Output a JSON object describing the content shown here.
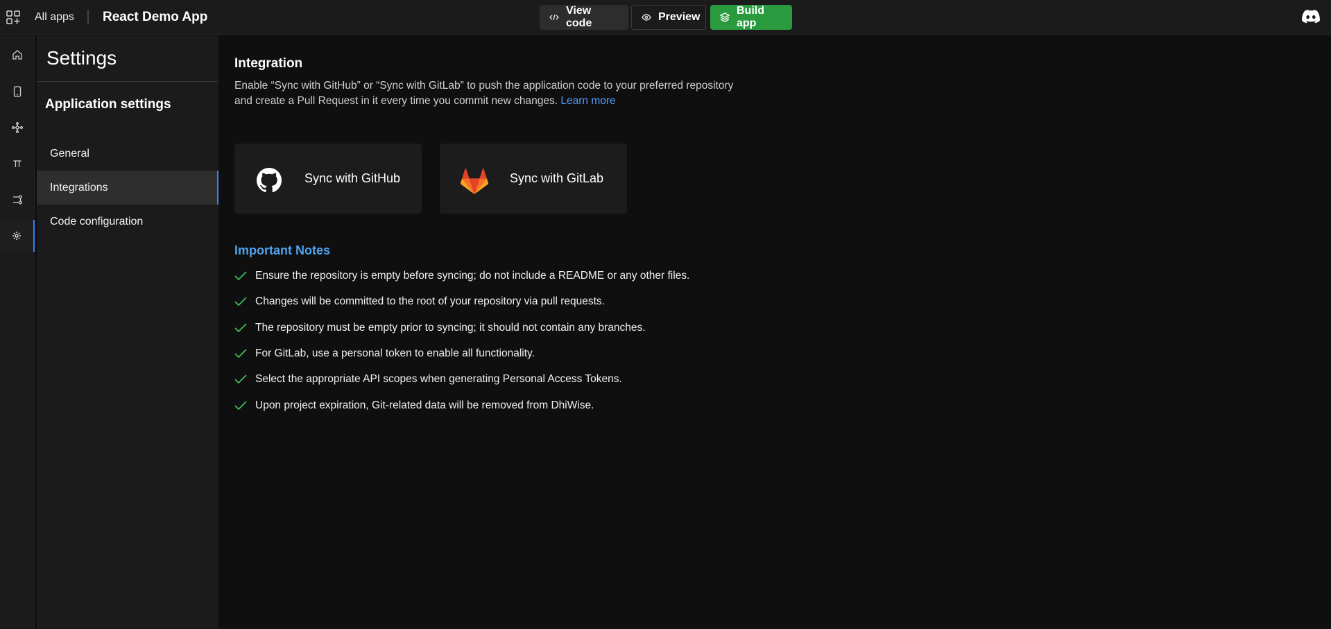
{
  "topbar": {
    "all_apps": "All apps",
    "app_title": "React Demo App",
    "view_code": "View code",
    "preview": "Preview",
    "build_app": "Build app"
  },
  "rail": {
    "items": [
      "home-icon",
      "device-icon",
      "nodes-icon",
      "pi-icon",
      "flow-icon",
      "gear-icon"
    ],
    "active": "gear-icon"
  },
  "settings": {
    "title": "Settings",
    "section": "Application settings",
    "nav": [
      {
        "label": "General"
      },
      {
        "label": "Integrations"
      },
      {
        "label": "Code configuration"
      }
    ],
    "active_nav": "Integrations"
  },
  "main": {
    "heading": "Integration",
    "description": "Enable “Sync with GitHub” or “Sync with GitLab” to push the application code to your preferred repository and create a Pull Request in it every time you commit new changes.",
    "learn_more": "Learn more",
    "github_label": "Sync with GitHub",
    "gitlab_label": "Sync with GitLab",
    "notes_title": "Important Notes",
    "notes": [
      "Ensure the repository is empty before syncing; do not include a README or any other files.",
      "Changes will be committed to the root of your repository via pull requests.",
      "The repository must be empty prior to syncing; it should not contain any branches.",
      "For GitLab, use a personal token to enable all functionality.",
      "Select the appropriate API scopes when generating Personal Access Tokens.",
      "Upon project expiration, Git-related data will be removed from DhiWise."
    ]
  },
  "colors": {
    "accent_blue": "#3b82f6",
    "build_green": "#2a9a3f",
    "link_blue": "#4f9dff",
    "check_green": "#3fbf5a"
  }
}
